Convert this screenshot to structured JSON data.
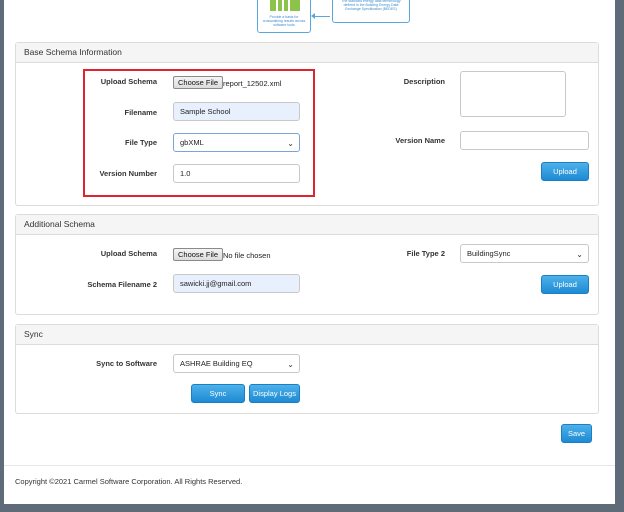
{
  "diagram": {
    "box1_text": "Provide a basis for crosswalking results across software tools",
    "box2_text": "The standard energy data terminology defined in the Building Energy Data Exchange Specification (BEDES)"
  },
  "base_schema": {
    "title": "Base Schema Information",
    "upload_label": "Upload Schema",
    "choose_file_label": "Choose File",
    "chosen_file": "report_12502.xml",
    "filename_label": "Filename",
    "filename_value": "Sample School",
    "filetype_label": "File Type",
    "filetype_value": "gbXML",
    "version_number_label": "Version Number",
    "version_number_value": "1.0",
    "description_label": "Description",
    "version_name_label": "Version Name",
    "version_name_value": "",
    "upload_button": "Upload"
  },
  "additional_schema": {
    "title": "Additional Schema",
    "upload_label": "Upload Schema",
    "choose_file_label": "Choose File",
    "chosen_file": "No file chosen",
    "filename2_label": "Schema Filename 2",
    "filename2_value": "sawicki.jj@gmail.com",
    "filetype2_label": "File Type 2",
    "filetype2_value": "BuildingSync",
    "upload_button": "Upload"
  },
  "sync": {
    "title": "Sync",
    "software_label": "Sync to Software",
    "software_value": "ASHRAE Building EQ",
    "sync_button": "Sync",
    "logs_button": "Display Logs"
  },
  "save_button": "Save",
  "copyright": "Copyright ©2021 Carmel Software Corporation. All Rights Reserved.",
  "colors": {
    "accent": "#1d8ad3",
    "highlight_border": "#e0242f",
    "autofill_bg": "#e8f0fe"
  }
}
